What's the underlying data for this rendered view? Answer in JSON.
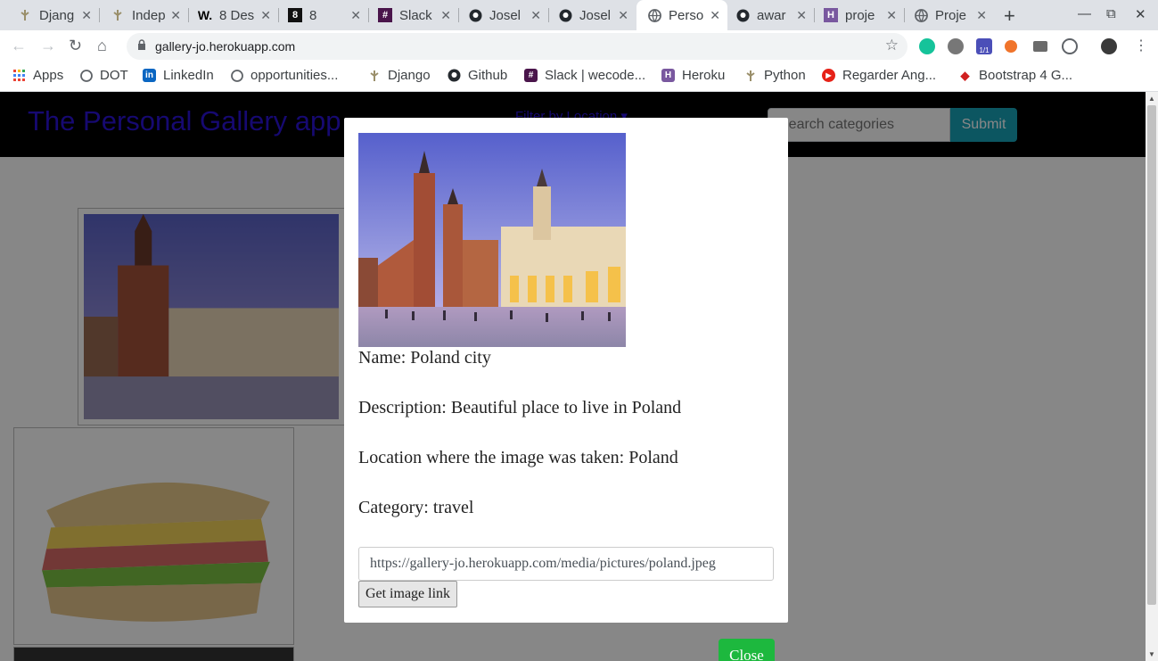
{
  "browser": {
    "tabs": [
      {
        "title": "Djang",
        "icon": "django-icon"
      },
      {
        "title": "Indep",
        "icon": "django-icon"
      },
      {
        "title": "8 Des",
        "icon": "w-icon"
      },
      {
        "title": "8",
        "icon": "8-icon"
      },
      {
        "title": "Slack",
        "icon": "slack-icon"
      },
      {
        "title": "Josel",
        "icon": "github-icon"
      },
      {
        "title": "Josel",
        "icon": "github-icon"
      },
      {
        "title": "Perso",
        "icon": "globe-icon"
      },
      {
        "title": "awar",
        "icon": "github-icon"
      },
      {
        "title": "proje",
        "icon": "heroku-icon"
      },
      {
        "title": "Proje",
        "icon": "globe-icon"
      }
    ],
    "url": "gallery-jo.herokuapp.com",
    "bookmarks": [
      {
        "label": "Apps",
        "icon": "apps-grid-icon"
      },
      {
        "label": "DOT",
        "icon": "globe-icon"
      },
      {
        "label": "LinkedIn",
        "icon": "linkedin-icon"
      },
      {
        "label": "opportunities...",
        "icon": "globe-icon"
      },
      {
        "label": "Django",
        "icon": "django-icon"
      },
      {
        "label": "Github",
        "icon": "github-icon"
      },
      {
        "label": "Slack | wecode...",
        "icon": "slack-icon"
      },
      {
        "label": "Heroku",
        "icon": "heroku-icon"
      },
      {
        "label": "Python",
        "icon": "django-icon"
      },
      {
        "label": "Regarder Ang...",
        "icon": "play-icon"
      },
      {
        "label": "Bootstrap 4 G...",
        "icon": "bug-icon"
      }
    ],
    "extension_badge": "1/1"
  },
  "site": {
    "brand": "The Personal Gallery app",
    "filter_label": "Filter by Location",
    "search_placeholder": "Search categories",
    "submit_label": "Submit"
  },
  "modal": {
    "name_line": "Name: Poland city",
    "description_line": "Description: Beautiful place to live in Poland",
    "location_line": "Location where the image was taken: Poland",
    "category_line": "Category: travel",
    "image_link": "https://gallery-jo.herokuapp.com/media/pictures/poland.jpeg",
    "get_link_label": "Get image link",
    "close_label": "Close"
  },
  "colors": {
    "brand": "#2a12d6",
    "submit": "#17a2b8",
    "close": "#1db83e"
  }
}
